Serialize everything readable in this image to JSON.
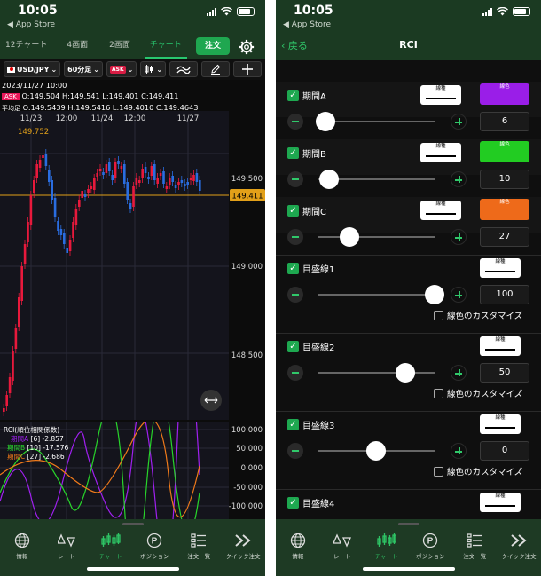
{
  "status": {
    "time": "10:05",
    "back_app": "◀ App Store"
  },
  "left": {
    "tabs": [
      {
        "label": "12チャート",
        "active": false
      },
      {
        "label": "4画面",
        "active": false
      },
      {
        "label": "2画面",
        "active": false
      },
      {
        "label": "チャート",
        "active": true
      }
    ],
    "order_button": "注文",
    "toolbar": {
      "pair": "USD/JPY",
      "timeframe": "60分足",
      "side": "ASK"
    },
    "quote": {
      "date": "2023/11/27 10:00",
      "ask_tag": "ASK",
      "ask_line": "O:149.504  H:149.541  L:149.401  C:149.411",
      "avg_tag": "平均足",
      "avg_line": "O:149.5439 H:149.5416 L:149.4010 C:149.4643"
    },
    "chart": {
      "x_labels": [
        "11/23",
        "12:00",
        "11/24",
        "12:00",
        "11/27"
      ],
      "y_labels": [
        "149.500",
        "149.000",
        "148.500"
      ],
      "high_marker": "149.752",
      "current_price": "149.411",
      "colors": {
        "up": "#e8193c",
        "down": "#2a6de0",
        "price_line": "#e2a019"
      }
    },
    "rci": {
      "title": "RCI(順位相関係数)",
      "series": [
        {
          "name": "期間A",
          "period": "[6]",
          "value": "-2.857",
          "color": "#a020f0"
        },
        {
          "name": "期間B",
          "period": "[10]",
          "value": "-17.576",
          "color": "#28d52b"
        },
        {
          "name": "期間C",
          "period": "[27]",
          "value": "-2.686",
          "color": "#f07a1a"
        }
      ],
      "y_labels": [
        "100.000",
        "50.000",
        "0.000",
        "-50.000",
        "-100.000"
      ]
    },
    "nav": [
      {
        "label": "情報",
        "icon": "globe-icon",
        "active": false
      },
      {
        "label": "レート",
        "icon": "rate-icon",
        "active": false
      },
      {
        "label": "チャート",
        "icon": "chart-icon",
        "active": true
      },
      {
        "label": "ポジション",
        "icon": "position-icon",
        "active": false
      },
      {
        "label": "注文一覧",
        "icon": "order-list-icon",
        "active": false
      },
      {
        "label": "クイック注文",
        "icon": "quick-order-icon",
        "active": false
      }
    ]
  },
  "right": {
    "back_label": "戻る",
    "title": "RCI",
    "line_type_label": "線種",
    "color_label": "線色",
    "custom_label": "線色のカスタマイズ",
    "periods": [
      {
        "label": "期間A",
        "value": "6",
        "slider": 0.07,
        "color": "#9a1ee8"
      },
      {
        "label": "期間B",
        "value": "10",
        "slider": 0.1,
        "color": "#22cc22"
      },
      {
        "label": "期間C",
        "value": "27",
        "slider": 0.27,
        "color": "#ee6a1a"
      }
    ],
    "levels": [
      {
        "label": "目盛線1",
        "value": "100",
        "slider": 1.0
      },
      {
        "label": "目盛線2",
        "value": "50",
        "slider": 0.75
      },
      {
        "label": "目盛線3",
        "value": "0",
        "slider": 0.5
      },
      {
        "label": "目盛線4"
      }
    ]
  }
}
